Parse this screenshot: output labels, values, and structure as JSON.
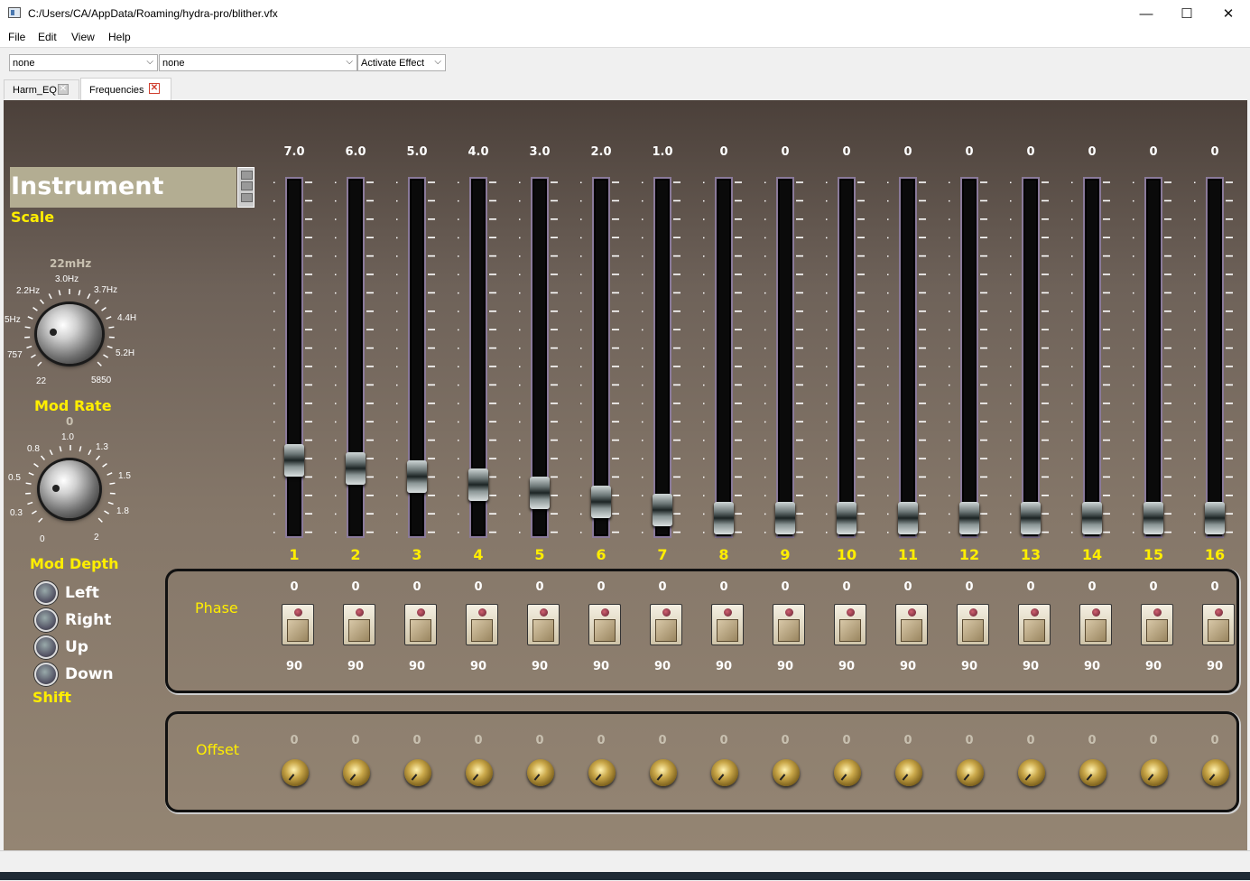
{
  "window": {
    "title": "C:/Users/CA/AppData/Roaming/hydra-pro/blither.vfx",
    "minimize": "—",
    "maximize": "☐",
    "close": "✕"
  },
  "menu": [
    "File",
    "Edit",
    "View",
    "Help"
  ],
  "toolbar": {
    "combo1": "none",
    "combo2": "none",
    "combo3": "Activate Effect"
  },
  "tabs": [
    {
      "label": "Harm_EQ",
      "active": false
    },
    {
      "label": "Frequencies",
      "active": true
    }
  ],
  "scale": {
    "value": "Instrument",
    "label": "Scale"
  },
  "mod_rate": {
    "label": "Mod Rate",
    "value": "22mHz",
    "ticks": [
      "2.2Hz",
      "3.0Hz",
      "3.7Hz",
      "5Hz",
      "4.4H",
      "757",
      "5.2H",
      "22",
      "5850"
    ]
  },
  "mod_depth": {
    "label": "Mod Depth",
    "value": "0",
    "ticks": [
      "0.8",
      "1.0",
      "1.3",
      "0.5",
      "1.5",
      "0.3",
      "1.8",
      "0",
      "2"
    ]
  },
  "shift": {
    "label": "Shift",
    "options": [
      "Left",
      "Right",
      "Up",
      "Down"
    ]
  },
  "sliders": [
    {
      "index": "1",
      "value": "7.0",
      "level": 7
    },
    {
      "index": "2",
      "value": "6.0",
      "level": 6
    },
    {
      "index": "3",
      "value": "5.0",
      "level": 5
    },
    {
      "index": "4",
      "value": "4.0",
      "level": 4
    },
    {
      "index": "5",
      "value": "3.0",
      "level": 3
    },
    {
      "index": "6",
      "value": "2.0",
      "level": 2
    },
    {
      "index": "7",
      "value": "1.0",
      "level": 1
    },
    {
      "index": "8",
      "value": "0",
      "level": 0
    },
    {
      "index": "9",
      "value": "0",
      "level": 0
    },
    {
      "index": "10",
      "value": "0",
      "level": 0
    },
    {
      "index": "11",
      "value": "0",
      "level": 0
    },
    {
      "index": "12",
      "value": "0",
      "level": 0
    },
    {
      "index": "13",
      "value": "0",
      "level": 0
    },
    {
      "index": "14",
      "value": "0",
      "level": 0
    },
    {
      "index": "15",
      "value": "0",
      "level": 0
    },
    {
      "index": "16",
      "value": "0",
      "level": 0
    }
  ],
  "phase": {
    "label": "Phase",
    "top_value": "0",
    "bottom_value": "90"
  },
  "offset": {
    "label": "Offset",
    "value": "0"
  },
  "colors": {
    "accent_yellow": "#ffee00",
    "panel_top": "#4b403a",
    "panel_bottom": "#948573"
  }
}
